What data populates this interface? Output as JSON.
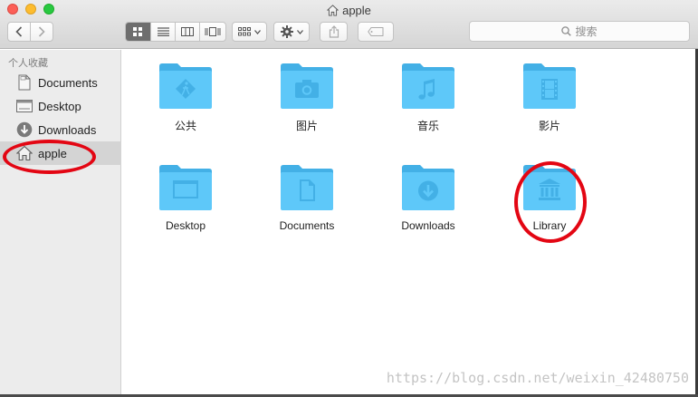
{
  "window": {
    "title": "apple"
  },
  "toolbar": {
    "back_icon": "chevron-left-icon",
    "forward_icon": "chevron-right-icon",
    "view_modes": [
      "icon-view",
      "list-view",
      "column-view",
      "cover-flow-view"
    ],
    "search_placeholder": "搜索"
  },
  "sidebar": {
    "heading": "个人收藏",
    "items": [
      {
        "label": "Documents",
        "icon": "document-icon",
        "active": false
      },
      {
        "label": "Desktop",
        "icon": "desktop-icon",
        "active": false
      },
      {
        "label": "Downloads",
        "icon": "download-icon",
        "active": false
      },
      {
        "label": "apple",
        "icon": "home-icon",
        "active": true
      }
    ]
  },
  "folders": [
    {
      "label": "公共",
      "icon": "public-icon"
    },
    {
      "label": "图片",
      "icon": "camera-icon"
    },
    {
      "label": "音乐",
      "icon": "music-icon"
    },
    {
      "label": "影片",
      "icon": "film-icon"
    },
    {
      "label": "Desktop",
      "icon": "desktop-icon"
    },
    {
      "label": "Documents",
      "icon": "document-icon"
    },
    {
      "label": "Downloads",
      "icon": "download-icon"
    },
    {
      "label": "Library",
      "icon": "library-icon"
    }
  ],
  "watermark": "https://blog.csdn.net/weixin_42480750",
  "colors": {
    "folder": "#5ec8f9",
    "folder_dark": "#43b0e6",
    "annotation": "#e30613"
  }
}
